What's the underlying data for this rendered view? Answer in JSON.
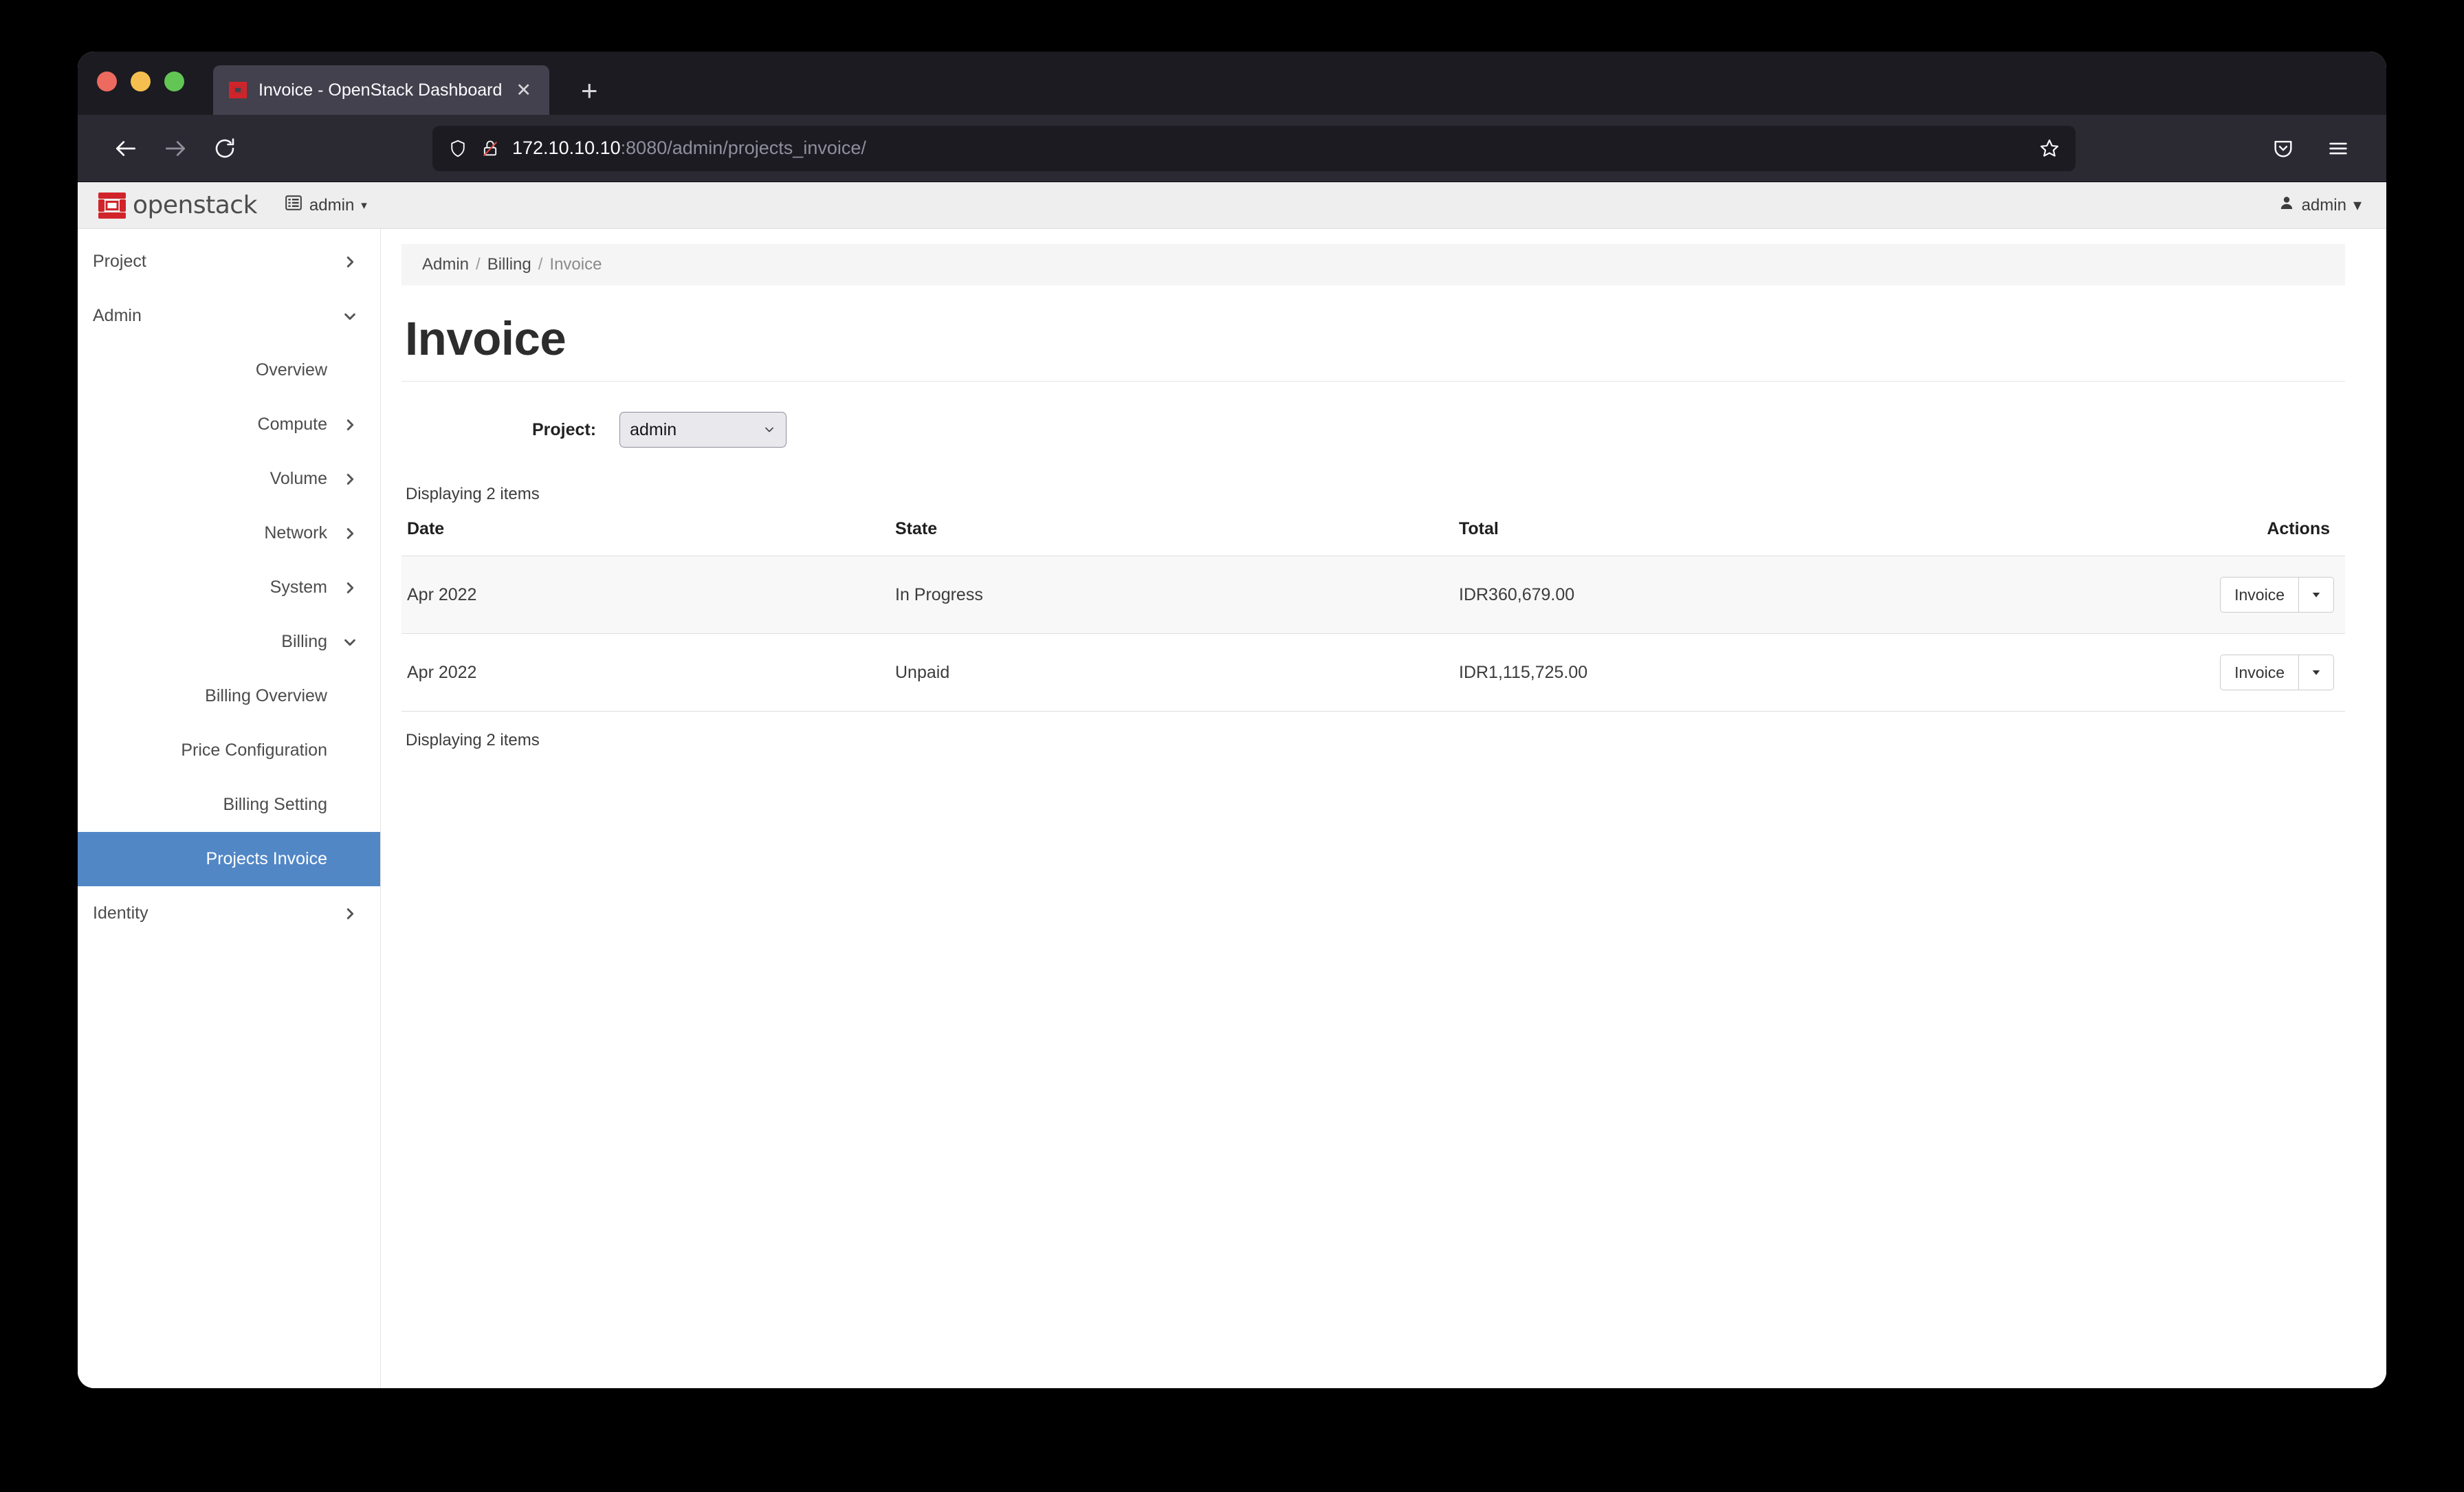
{
  "browser": {
    "tab": {
      "title": "Invoice - OpenStack Dashboard",
      "close_label": "✕",
      "favicon_name": "openstack-favicon"
    },
    "new_tab_label": "+",
    "nav": {
      "back_label": "←",
      "forward_label": "→",
      "reload_label": "⟳"
    },
    "url": {
      "host": "172.10.10.10",
      "rest": ":8080/admin/projects_invoice/"
    },
    "icons": {
      "shield": "shield-icon",
      "lock_broken": "broken-lock-icon",
      "star": "bookmark-star-icon",
      "pocket": "pocket-icon",
      "menu": "hamburger-menu-icon"
    }
  },
  "topbar": {
    "logo_text": "openstack",
    "logo_mark_color": "#d0242a",
    "project_switcher": {
      "label": "admin",
      "caret": "▾",
      "icon": "grid-list-icon"
    },
    "user_menu": {
      "label": "admin",
      "caret": "▾",
      "icon": "user-icon"
    }
  },
  "sidebar": {
    "items": [
      {
        "label": "Project",
        "level": 0,
        "chevron": "right",
        "active": false
      },
      {
        "label": "Admin",
        "level": 0,
        "chevron": "down",
        "active": false
      },
      {
        "label": "Overview",
        "level": 1,
        "chevron": "none",
        "active": false
      },
      {
        "label": "Compute",
        "level": 1,
        "chevron": "right",
        "active": false
      },
      {
        "label": "Volume",
        "level": 1,
        "chevron": "right",
        "active": false
      },
      {
        "label": "Network",
        "level": 1,
        "chevron": "right",
        "active": false
      },
      {
        "label": "System",
        "level": 1,
        "chevron": "right",
        "active": false
      },
      {
        "label": "Billing",
        "level": 1,
        "chevron": "down",
        "active": false
      },
      {
        "label": "Billing Overview",
        "level": 2,
        "chevron": "none",
        "active": false
      },
      {
        "label": "Price Configuration",
        "level": 2,
        "chevron": "none",
        "active": false
      },
      {
        "label": "Billing Setting",
        "level": 2,
        "chevron": "none",
        "active": false
      },
      {
        "label": "Projects Invoice",
        "level": 2,
        "chevron": "none",
        "active": true
      },
      {
        "label": "Identity",
        "level": 0,
        "chevron": "right",
        "active": false
      }
    ],
    "active_color": "#5287c6"
  },
  "main": {
    "breadcrumb": {
      "items": [
        "Admin",
        "Billing"
      ],
      "separator": "/",
      "current": "Invoice"
    },
    "page_title": "Invoice",
    "filter": {
      "label": "Project:",
      "selected": "admin",
      "options": [
        "admin"
      ],
      "caret": "⌄"
    },
    "count_top": "Displaying 2 items",
    "count_bottom": "Displaying 2 items",
    "table": {
      "columns": [
        "Date",
        "State",
        "Total",
        "Actions"
      ],
      "rows": [
        {
          "date": "Apr 2022",
          "state": "In Progress",
          "total": "IDR360,679.00",
          "action_label": "Invoice",
          "action_caret": "▾"
        },
        {
          "date": "Apr 2022",
          "state": "Unpaid",
          "total": "IDR1,115,725.00",
          "action_label": "Invoice",
          "action_caret": "▾"
        }
      ]
    }
  }
}
